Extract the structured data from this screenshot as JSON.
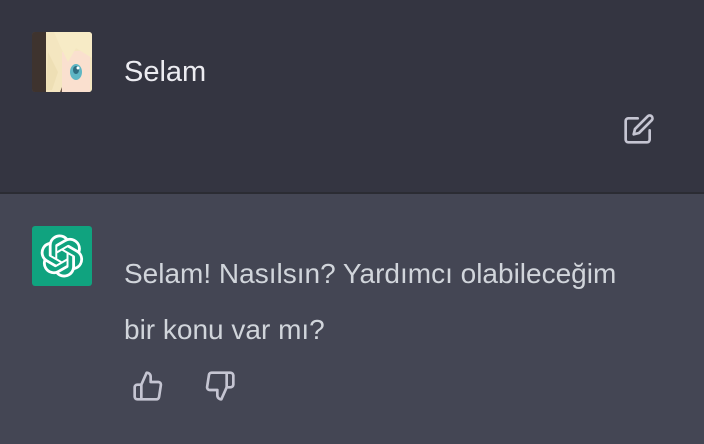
{
  "conversation": {
    "user_message": {
      "text": "Selam",
      "avatar_icon": "anime-girl-avatar",
      "edit_icon": "edit-icon"
    },
    "assistant_message": {
      "text": "Selam! Nasılsın? Yardımcı olabileceğim bir konu var mı?",
      "avatar_icon": "openai-logo-icon",
      "feedback": {
        "thumbs_up_icon": "thumbs-up-icon",
        "thumbs_down_icon": "thumbs-down-icon"
      }
    }
  },
  "colors": {
    "user_bg": "#343541",
    "assistant_bg": "#444654",
    "accent": "#10a37f",
    "icon": "#c5c5d2"
  }
}
